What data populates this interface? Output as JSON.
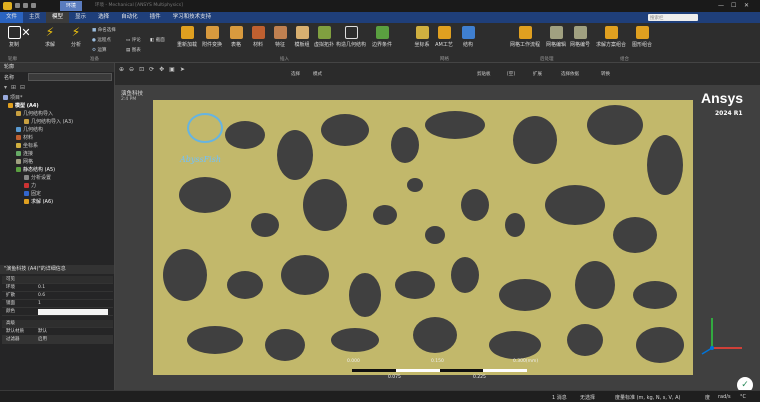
{
  "titlebar": {
    "tab": "环境",
    "title": "环境 - Mechanical [ANSYS Multiphysics]",
    "search_placeholder": "搜索栏"
  },
  "menu": {
    "file": "文件",
    "items": [
      "主页",
      "模型",
      "显示",
      "选择",
      "自动化",
      "插件",
      "学习和技术支持"
    ]
  },
  "ribbon": {
    "buttons": [
      {
        "label": "复制",
        "icon": "copy-icon",
        "color": "#ffffff"
      },
      {
        "label": "删除",
        "icon": "delete-icon",
        "color": "#ffffff"
      },
      {
        "label": "求解",
        "icon": "solve-icon",
        "color": "#f1c40f"
      },
      {
        "label": "分析",
        "icon": "analysis-icon",
        "color": "#f1c40f"
      },
      {
        "label": "重新加载",
        "icon": "reload-icon",
        "color": "#e0a020"
      },
      {
        "label": "附件变换",
        "icon": "attachment-icon",
        "color": "#d89a3e"
      },
      {
        "label": "表格",
        "icon": "table-icon",
        "color": "#d89a3e"
      },
      {
        "label": "材料",
        "icon": "material-icon",
        "color": "#c06030"
      },
      {
        "label": "特征",
        "icon": "feature-icon",
        "color": "#c08050"
      },
      {
        "label": "模板组",
        "icon": "template-icon",
        "color": "#d9b070"
      },
      {
        "label": "虚拟拓扑",
        "icon": "virtual-topology-icon",
        "color": "#80a040"
      },
      {
        "label": "构造几何结构",
        "icon": "construction-icon",
        "color": "#d0d0d0"
      },
      {
        "label": "边界条件",
        "icon": "boundary-icon",
        "color": "#5aa040"
      },
      {
        "label": "坐标系",
        "icon": "coordinate-icon",
        "color": "#d0b040"
      },
      {
        "label": "AM工艺",
        "icon": "am-process-icon",
        "color": "#e0a020"
      },
      {
        "label": "结构",
        "icon": "structure-icon",
        "color": "#3f7fd0"
      },
      {
        "label": "网格工作流程",
        "icon": "mesh-workflow-icon",
        "color": "#e0a020"
      },
      {
        "label": "网格编辑",
        "icon": "mesh-edit-icon",
        "color": "#a0a080"
      },
      {
        "label": "网格编号",
        "icon": "mesh-number-icon",
        "color": "#a0a080"
      },
      {
        "label": "求解方案组合",
        "icon": "solution-combo-icon",
        "color": "#e0a020"
      },
      {
        "label": "图形组合",
        "icon": "graph-combo-icon",
        "color": "#e0a020"
      }
    ],
    "small": [
      "命名选择",
      "远程点",
      "运算",
      "评论",
      "图表",
      "截面"
    ],
    "groups": [
      "轮廓",
      "准备",
      "插入",
      "网格",
      "后处理",
      "组合"
    ]
  },
  "outline": {
    "title": "轮廓",
    "search_label": "名称",
    "search_placeholder": "搜索轮廓",
    "tree": [
      "项目*",
      "模型 (A4)",
      "几何结构导入",
      "几何结构导入 (A3)",
      "几何结构",
      "材料",
      "坐标系",
      "连接",
      "网格",
      "静态结构 (A5)",
      "分析设置",
      "力",
      "固定",
      "求解 (A6)"
    ]
  },
  "details": {
    "title": "\"演鱼科技 (A4)\"的详细信息",
    "sections": [
      "可见",
      "高级"
    ],
    "rows": [
      {
        "k": "可见",
        "v": ""
      },
      {
        "k": "环境",
        "v": "0.1"
      },
      {
        "k": "扩散",
        "v": "0.6"
      },
      {
        "k": "镜面",
        "v": "1"
      },
      {
        "k": "颜色",
        "v": ""
      },
      {
        "k": "高级",
        "v": ""
      },
      {
        "k": "默认材质",
        "v": "默认"
      },
      {
        "k": "过滤器",
        "v": "启用"
      }
    ]
  },
  "view_toolbar": {
    "select": "选择",
    "mode": "模式",
    "clipboard": "剪贴板",
    "empty": "[空]",
    "extend": "扩展",
    "select_by": "选择依据",
    "convert": "转换"
  },
  "viewport": {
    "title": "演鱼科技",
    "timestamp": "2:4 PM",
    "brand": "Ansys",
    "version": "2024 R1",
    "watermark": "AbyssFish",
    "scale_labels": [
      "0.000",
      "0.150",
      "0.300(mm)",
      "0.075",
      "0.225"
    ],
    "bg": "#404040",
    "material": "#c2b86b"
  },
  "statusbar": {
    "messages": "1 消息",
    "selection": "无选择",
    "units": "度量标准 (m, kg, N, s, V, A)",
    "angle": "度",
    "speed": "rad/s",
    "temp": "°C"
  }
}
